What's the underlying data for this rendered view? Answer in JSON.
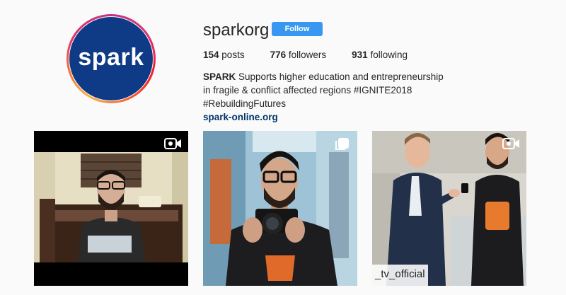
{
  "profile": {
    "avatar_text": "spark",
    "username": "sparkorg",
    "follow_label": "Follow",
    "stats": {
      "posts_count": "154",
      "posts_label": "posts",
      "followers_count": "776",
      "followers_label": "followers",
      "following_count": "931",
      "following_label": "following"
    },
    "bio": {
      "name": "SPARK",
      "text": " Supports higher education and entrepreneurship in fragile & conflict affected regions #IGNITE2018 #RebuildingFutures",
      "link": "spark-online.org"
    },
    "colors": {
      "follow_button": "#3897f0",
      "link": "#003569",
      "avatar_bg": "#0f3a86"
    }
  },
  "posts": [
    {
      "type": "video",
      "badge_icon": "video-camera-icon"
    },
    {
      "type": "multi",
      "badge_icon": "carousel-icon"
    },
    {
      "type": "video",
      "badge_icon": "video-camera-icon",
      "caption": "_tv_official"
    }
  ]
}
